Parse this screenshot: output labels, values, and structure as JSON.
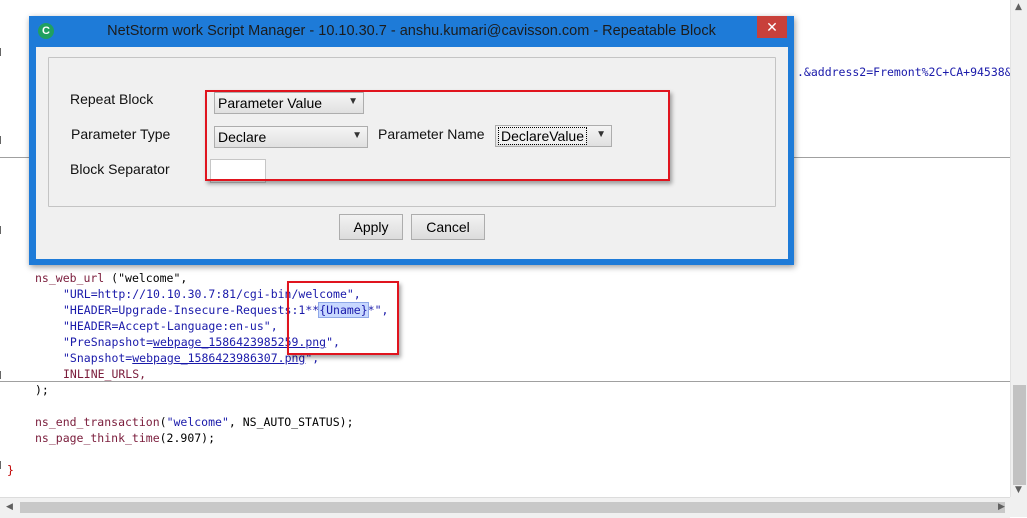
{
  "editor": {
    "partial_url": ".&address2=Fremont%2C+CA+94538&p",
    "lines": {
      "web_url_fn": "ns_web_url",
      "web_url_arg": " (\"welcome\",",
      "url": "\"URL=http://10.10.30.7:81/cgi-bin/welcome\",",
      "header1_pre": "\"HEADER=Upgrade-Insecure-Requests:1**",
      "header1_var": "{Uname}",
      "header1_post": "*\",",
      "header2": "\"HEADER=Accept-Language:en-us\",",
      "presnap_pre": "\"PreSnapshot=",
      "presnap_link": "webpage_1586423985259.png",
      "presnap_post": "\",",
      "snap_pre": "\"Snapshot=",
      "snap_link": "webpage_1586423986307.png",
      "snap_post": "\",",
      "inline": "INLINE_URLS,",
      "close_paren": ");",
      "end_txn_fn": "ns_end_transaction",
      "end_txn_arg1": "\"welcome\"",
      "end_txn_arg2": ", NS_AUTO_STATUS);",
      "think_fn": "ns_page_think_time",
      "think_arg": "(2.907);",
      "close_brace": "}"
    }
  },
  "dialog": {
    "title": "NetStorm work Script Manager - 10.10.30.7 - anshu.kumari@cavisson.com - Repeatable Block",
    "app_icon": "C",
    "close_icon": "✕",
    "repeat_block_label": "Repeat Block",
    "repeat_block_value": "Parameter Value",
    "parameter_type_label": "Parameter Type",
    "parameter_type_value": "Declare",
    "parameter_name_label": "Parameter Name",
    "parameter_name_value": "DeclareValue",
    "block_separator_label": "Block Separator",
    "block_separator_value": "",
    "apply_label": "Apply",
    "cancel_label": "Cancel"
  },
  "icons": {
    "dropdown": "chevron-down-icon",
    "scroll_up": "arrow-up-icon",
    "scroll_down": "arrow-down-icon",
    "scroll_left": "arrow-left-icon",
    "scroll_right": "arrow-right-icon"
  },
  "colors": {
    "dialog_frame": "#1e7bd8",
    "annotation": "#e0141e",
    "keyword": "#7a1c3b",
    "string": "#1a1aaa"
  }
}
